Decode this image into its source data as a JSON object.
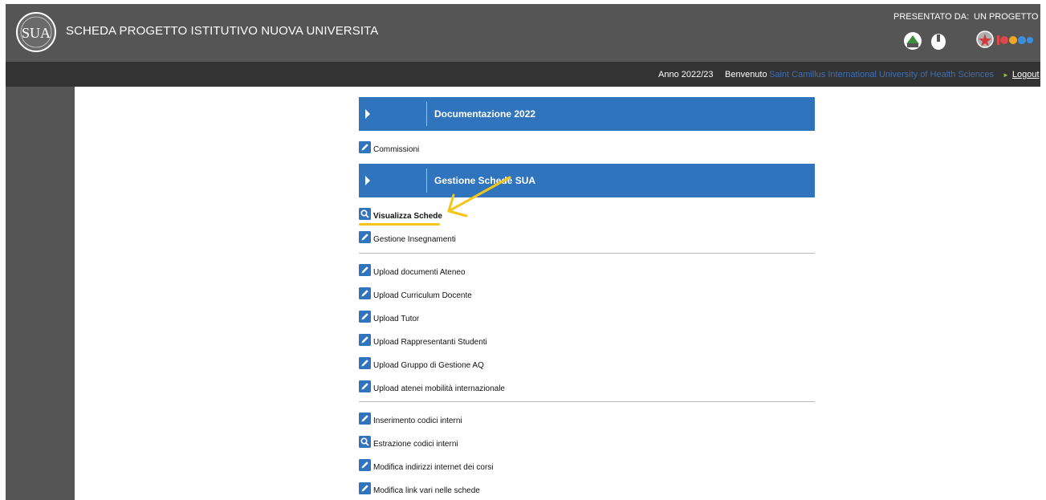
{
  "header": {
    "title": "SCHEDA PROGETTO ISTITUTIVO NUOVA UNIVERSITA",
    "logo_text": "SUA",
    "presented_by": "PRESENTATO DA:",
    "project_of": "UN PROGETTO DI:",
    "partners": [
      "anvur-logo-icon",
      "cineca-logo-icon",
      "italy-emblem-icon",
      "miur-logo-icon"
    ]
  },
  "topbar": {
    "year": "Anno 2022/23",
    "welcome": "Benvenuto",
    "university": "Saint Camillus International University of Health Sciences",
    "logout": "Logout"
  },
  "sections": [
    {
      "title": "Documentazione 2022"
    },
    {
      "title": "Gestione Schede SUA"
    }
  ],
  "menu": {
    "commissioni": "Commissioni",
    "visualizza_schede": "Visualizza Schede",
    "gestione_insegnamenti": "Gestione Insegnamenti",
    "upload_documenti_ateneo": "Upload documenti Ateneo",
    "upload_curriculum_docente": "Upload Curriculum Docente",
    "upload_tutor": "Upload Tutor",
    "upload_rappresentanti_studenti": "Upload Rappresentanti Studenti",
    "upload_gruppo_gestione_aq": "Upload Gruppo di Gestione AQ",
    "upload_atenei_mobilita": "Upload atenei mobilità internazionale",
    "inserimento_codici_interni": "Inserimento codici interni",
    "estrazione_codici_interni": "Estrazione codici interni",
    "modifica_indirizzi_internet": "Modifica indirizzi internet dei corsi",
    "modifica_link_vari": "Modifica link vari nelle schede"
  },
  "colors": {
    "header_bg": "#555555",
    "topbar_bg": "#333333",
    "section_blue": "#2f74bd",
    "university_link": "#3b6fb7",
    "annotation_yellow": "#f5c518"
  }
}
